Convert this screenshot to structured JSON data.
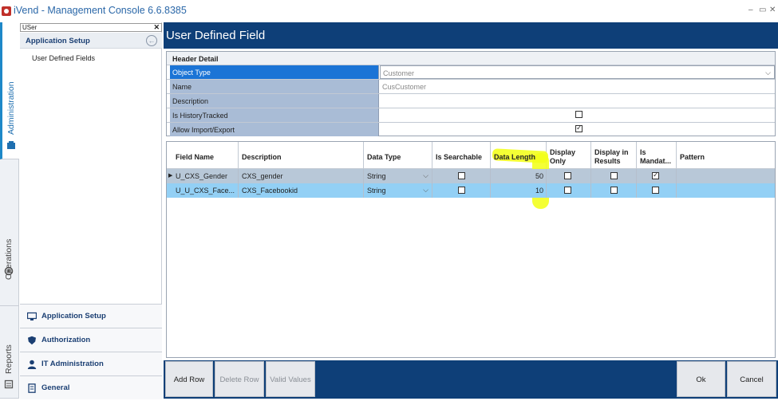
{
  "window": {
    "title": "iVend - Management Console  6.6.8385",
    "minimize": "–",
    "restore": "▭",
    "close": "✕"
  },
  "vtabs": [
    {
      "label": "Administration",
      "icon": "admin-icon"
    },
    {
      "label": "Operations",
      "icon": "gear-icon"
    },
    {
      "label": "Reports",
      "icon": "report-icon"
    }
  ],
  "sidebar": {
    "search_value": "USer",
    "search_clear": "✕",
    "section_title": "Application Setup",
    "items": [
      "User Defined Fields"
    ],
    "bottom_nav": [
      "Application Setup",
      "Authorization",
      "IT Administration",
      "General"
    ]
  },
  "main": {
    "title": "User Defined Field",
    "header_detail": {
      "title": "Header Detail",
      "rows": [
        {
          "label": "Object Type",
          "value": "Customer"
        },
        {
          "label": "Name",
          "value": "CusCustomer"
        },
        {
          "label": "Description",
          "value": ""
        },
        {
          "label": "Is HistoryTracked",
          "checked": false
        },
        {
          "label": "Allow Import/Export",
          "checked": true
        }
      ]
    },
    "grid": {
      "columns": [
        "Field Name",
        "Description",
        "Data Type",
        "Is Searchable",
        "Data Length",
        "Display Only",
        "Display in Results",
        "Is Mandat...",
        "Pattern"
      ],
      "rows": [
        {
          "field_name": "U_CXS_Gender",
          "description": "CXS_gender",
          "data_type": "String",
          "is_searchable": false,
          "data_length": "50",
          "display_only": false,
          "display_in_results": false,
          "is_mandatory": true,
          "pattern": ""
        },
        {
          "field_name": "U_U_CXS_Face...",
          "description": "CXS_Facebookid",
          "data_type": "String",
          "is_searchable": false,
          "data_length": "10",
          "display_only": false,
          "display_in_results": false,
          "is_mandatory": false,
          "pattern": ""
        }
      ]
    }
  },
  "toolbar": {
    "add_row": "Add Row",
    "delete_row": "Delete Row",
    "valid_values": "Valid Values",
    "ok": "Ok",
    "cancel": "Cancel"
  },
  "colors": {
    "header_bar": "#0e3f78",
    "selected_row": "#1b74d6",
    "label_cell": "#a9bcd6",
    "highlight": "#f2ff19"
  }
}
